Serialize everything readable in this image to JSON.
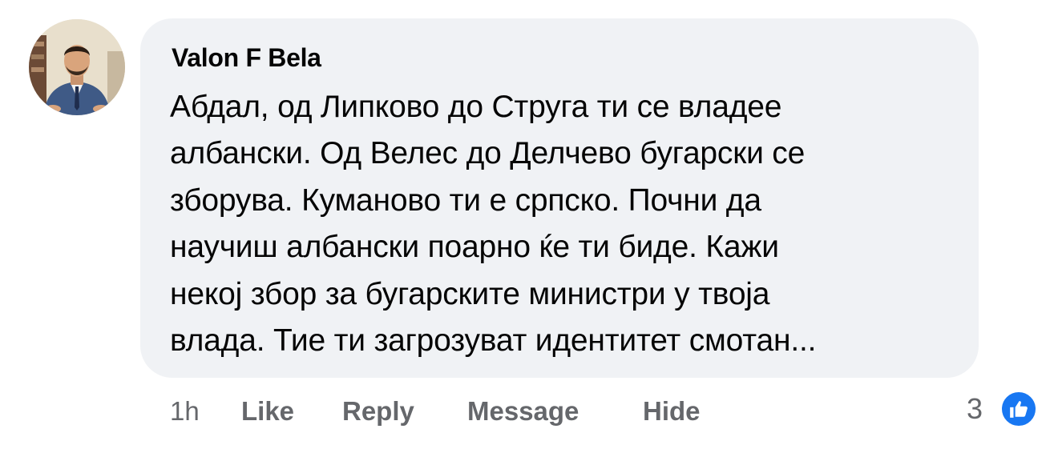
{
  "comment": {
    "author": "Valon F Bela",
    "text_lines": [
      "Абдал, од Липково до Струга ти се владее",
      "албански. Од Велес до Делчево бугарски се",
      "зборува. Куманово ти е српско. Почни да",
      "научиш албански поарно ќе ти биде. Кажи",
      "некој збор за бугарските министри у твоја",
      "влада. Тие ти загрозуват идентитет смотан..."
    ]
  },
  "actions": {
    "time": "1h",
    "like": "Like",
    "reply": "Reply",
    "message": "Message",
    "hide": "Hide"
  },
  "reactions": {
    "count": "3",
    "icon": "like-thumb-icon",
    "color": "#1877f2"
  },
  "colors": {
    "bubble": "#f0f2f5",
    "text": "#050505",
    "secondary": "#65676b"
  }
}
